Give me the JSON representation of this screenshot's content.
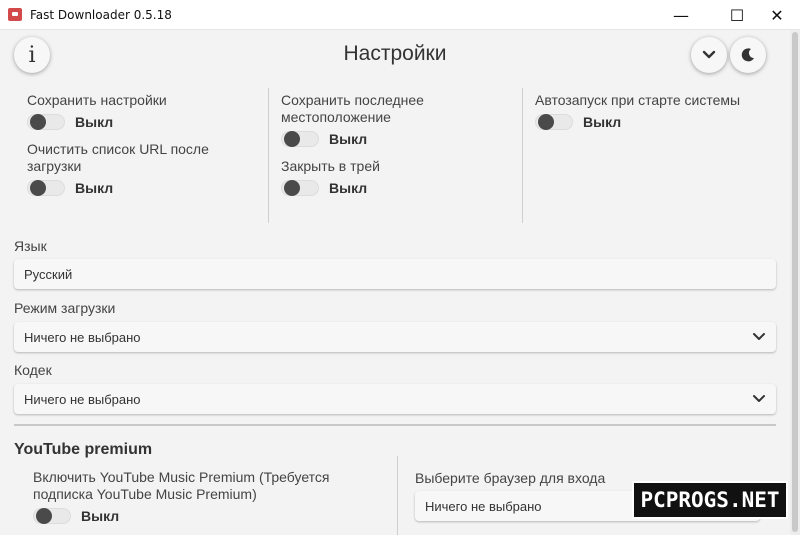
{
  "window": {
    "title": "Fast Downloader 0.5.18",
    "minimize": "—",
    "maximize": "☐",
    "close": "✕"
  },
  "header": {
    "info_icon": "info-icon",
    "info_glyph": "i",
    "title": "Настройки",
    "expand_icon": "chevron-down-icon",
    "theme_icon": "moon-icon"
  },
  "settings": {
    "col1": [
      {
        "label": "Сохранить настройки",
        "state": "Выкл"
      },
      {
        "label": "Очистить список URL после загрузки",
        "state": "Выкл"
      }
    ],
    "col2": [
      {
        "label": "Сохранить последнее местоположение",
        "state": "Выкл"
      },
      {
        "label": "Закрыть в трей",
        "state": "Выкл"
      }
    ],
    "col3": [
      {
        "label": "Автозапуск при старте системы",
        "state": "Выкл"
      }
    ]
  },
  "fields": {
    "language": {
      "label": "Язык",
      "value": "Русский"
    },
    "download_mode": {
      "label": "Режим загрузки",
      "value": "Ничего не выбрано"
    },
    "codec": {
      "label": "Кодек",
      "value": "Ничего не выбрано"
    }
  },
  "youtube": {
    "section_title": "YouTube premium",
    "premium_label": "Включить YouTube Music Premium (Требуется подписка YouTube Music Premium)",
    "premium_state": "Выкл",
    "browser_label": "Выберите браузер для входа",
    "browser_value": "Ничего не выбрано"
  },
  "watermark": "PCPROGS.NET",
  "colors": {
    "background": "#f3f3f3",
    "toggle_knob": "#4a4a4a",
    "app_icon": "#d24a4a"
  }
}
